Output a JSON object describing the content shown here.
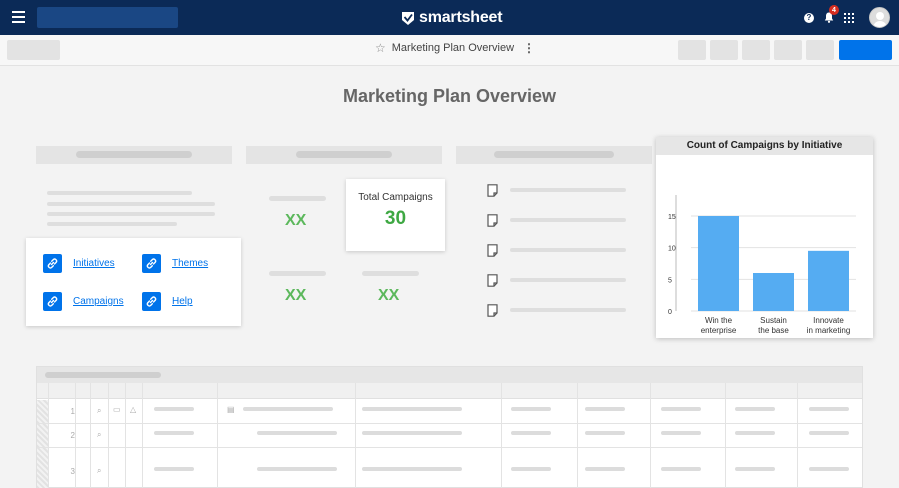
{
  "app": {
    "name": "smartsheet"
  },
  "topbar": {
    "help_icon": "help-icon",
    "notifications": {
      "icon": "bell-icon",
      "count": "4"
    },
    "apps_icon": "grid-icon"
  },
  "toolbar": {
    "doc_title": "Marketing Plan Overview",
    "star_icon": "star-icon",
    "more_icon": "kebab-icon"
  },
  "dashboard": {
    "title": "Marketing Plan Overview",
    "links": [
      {
        "label": "Initiatives",
        "icon": "link-icon"
      },
      {
        "label": "Themes",
        "icon": "link-icon"
      },
      {
        "label": "Campaigns",
        "icon": "link-icon"
      },
      {
        "label": "Help",
        "icon": "link-icon"
      }
    ],
    "metrics": {
      "placeholder_value": "XX",
      "total_label": "Total Campaigns",
      "total_value": "30"
    }
  },
  "chart_data": {
    "type": "bar",
    "title": "Count of Campaigns by Initiative",
    "categories": [
      "Win the enterprise",
      "Sustain the base",
      "Innovate in marketing"
    ],
    "category_lines": [
      [
        "Win the",
        "enterprise"
      ],
      [
        "Sustain",
        "the base"
      ],
      [
        "Innovate",
        "in marketing"
      ]
    ],
    "values": [
      15,
      6,
      9.5
    ],
    "yticks": [
      "0",
      "5",
      "10",
      "15"
    ],
    "ylim": [
      0,
      18
    ],
    "grid": true,
    "color": "#55acf2"
  },
  "sheet": {
    "row_numbers": [
      "1",
      "2",
      "3"
    ]
  },
  "colors": {
    "topbar": "#0b2a57",
    "accent": "#0073ea",
    "metric_green": "#5cb85c"
  }
}
